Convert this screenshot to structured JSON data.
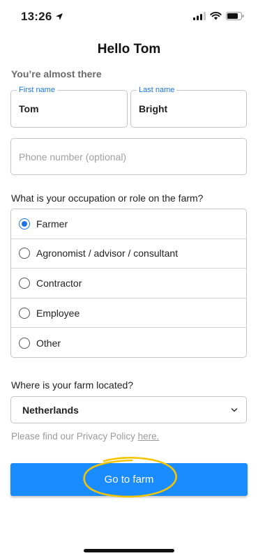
{
  "status_bar": {
    "time": "13:26",
    "icons": [
      "location-arrow-icon",
      "cellular-signal-icon",
      "wifi-icon",
      "battery-icon"
    ]
  },
  "header": {
    "title": "Hello Tom",
    "subtitle": "You’re almost there"
  },
  "form": {
    "first_name": {
      "label": "First name",
      "value": "Tom"
    },
    "last_name": {
      "label": "Last name",
      "value": "Bright"
    },
    "phone": {
      "placeholder": "Phone number (optional)",
      "value": ""
    },
    "occupation": {
      "question": "What is your occupation or role on the farm?",
      "options": [
        {
          "label": "Farmer",
          "selected": true
        },
        {
          "label": "Agronomist / advisor / consultant",
          "selected": false
        },
        {
          "label": "Contractor",
          "selected": false
        },
        {
          "label": "Employee",
          "selected": false
        },
        {
          "label": "Other",
          "selected": false
        }
      ]
    },
    "location": {
      "question": "Where is your farm located?",
      "selected": "Netherlands"
    }
  },
  "privacy": {
    "text": "Please find our Privacy Policy",
    "link": "here."
  },
  "primary_button": {
    "label": "Go to farm"
  },
  "colors": {
    "accent": "#1a73e8",
    "button": "#1a8cff",
    "highlight": "#f5c400",
    "border": "#c7c7c7"
  }
}
